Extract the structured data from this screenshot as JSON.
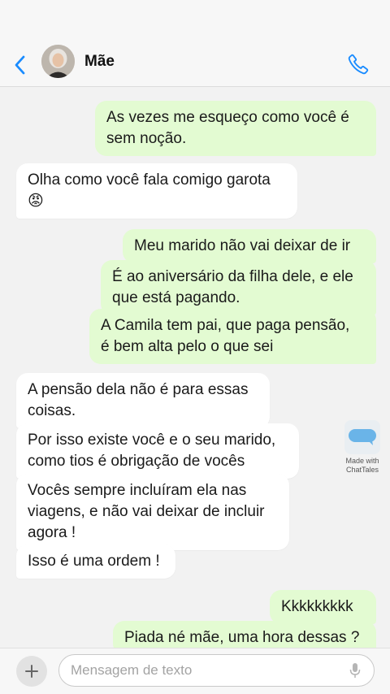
{
  "header": {
    "contact_name": "Mãe",
    "accent_color": "#1a8cff"
  },
  "messages": [
    {
      "side": "out",
      "text": "As vezes me esqueço como você é\nsem noção."
    },
    {
      "side": "in",
      "text": "Olha como você fala comigo garota\n😡"
    },
    {
      "side": "out",
      "text": "Meu marido não vai deixar de ir"
    },
    {
      "side": "out",
      "text": "É ao aniversário da filha dele, e ele\nque está pagando."
    },
    {
      "side": "out",
      "text": "A Camila tem pai, que paga pensão,\né bem alta pelo o que sei"
    },
    {
      "side": "in",
      "text": "A pensão dela não é para essas\ncoisas."
    },
    {
      "side": "in",
      "text": "Por isso existe você e o seu marido,\ncomo tios é obrigação de vocês"
    },
    {
      "side": "in",
      "text": "Vocês sempre incluíram ela nas\nviagens, e não vai deixar de incluir\nagora !"
    },
    {
      "side": "in",
      "text": "Isso é uma ordem !"
    },
    {
      "side": "out",
      "text": "Kkkkkkkkk"
    },
    {
      "side": "out",
      "text": "Piada né mãe, uma hora dessas ?"
    }
  ],
  "watermark": {
    "text": "Made with\nChatTales"
  },
  "composer": {
    "placeholder": "Mensagem de texto",
    "value": ""
  },
  "colors": {
    "outgoing_bubble": "#e3fbd2",
    "incoming_bubble": "#ffffff",
    "chat_background": "#f2f2f2"
  }
}
